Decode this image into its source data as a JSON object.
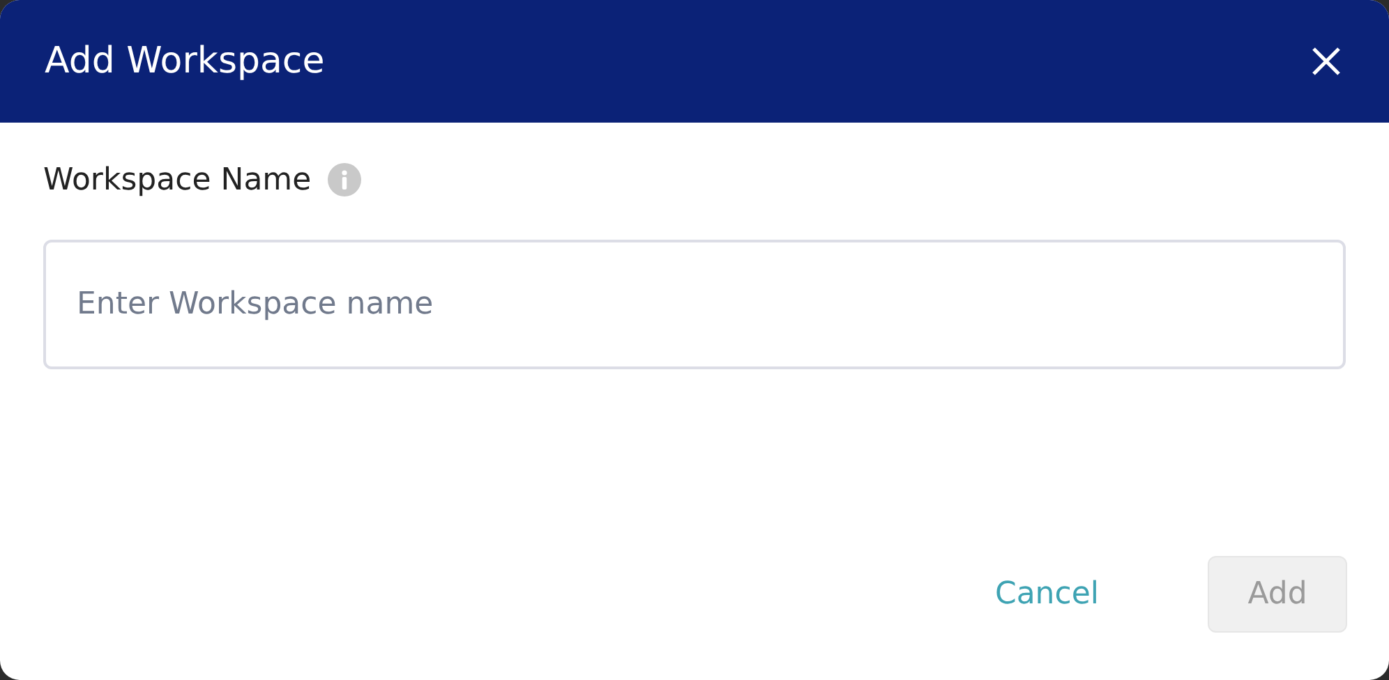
{
  "dialog": {
    "title": "Add Workspace"
  },
  "field": {
    "label": "Workspace Name",
    "placeholder": "Enter Workspace name"
  },
  "buttons": [
    {
      "label": "Cancel",
      "kind": "link",
      "disabled": false
    },
    {
      "label": "Add",
      "kind": "primary",
      "disabled": true
    }
  ]
}
